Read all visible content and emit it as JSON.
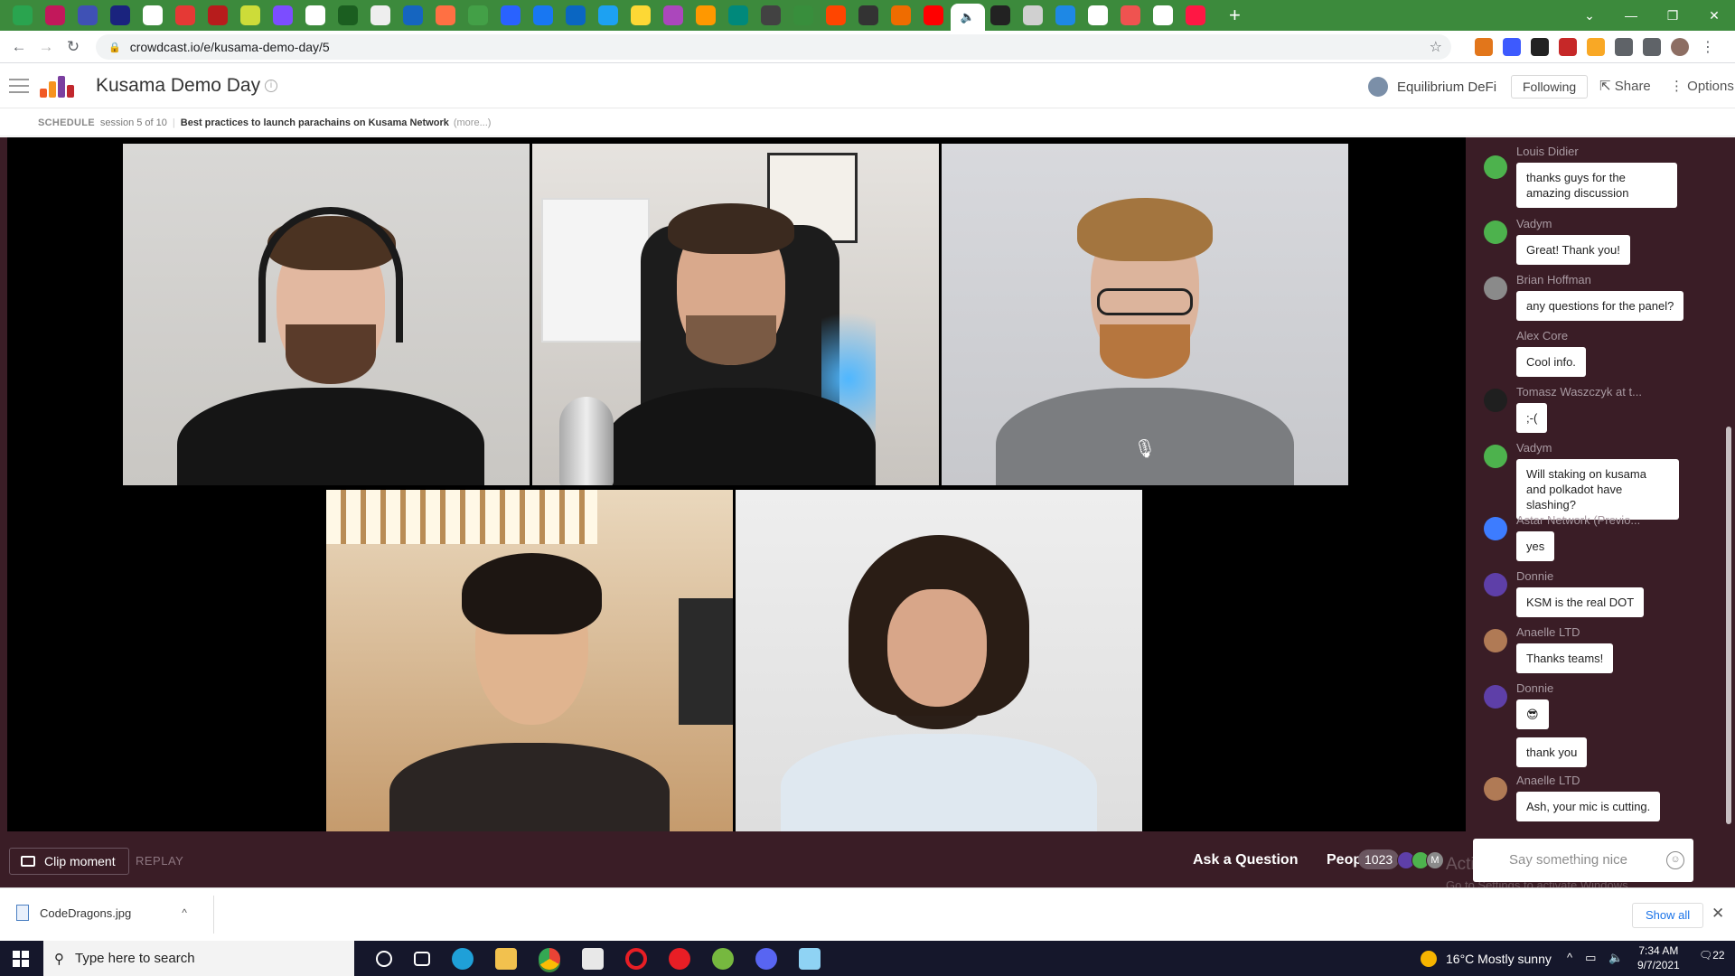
{
  "browser": {
    "url": "crowdcast.io/e/kusama-demo-day/5",
    "tab_audio_icon": "speaker-icon",
    "new_tab": "+",
    "window_controls": [
      "⌄",
      "—",
      "❐",
      "✕"
    ]
  },
  "header": {
    "title": "Kusama Demo Day",
    "host_name": "Equilibrium DeFi",
    "following_label": "Following",
    "share_label": "Share",
    "options_label": "Options"
  },
  "schedule": {
    "label": "SCHEDULE",
    "session": "session 5 of 10",
    "session_title": "Best practices to launch parachains on Kusama Network",
    "more": "(more...)"
  },
  "controls": {
    "clip_label": "Clip moment",
    "replay_label": "REPLAY",
    "ask_label": "Ask a Question",
    "people_label": "People",
    "people_count": "1023"
  },
  "chat": {
    "messages": [
      {
        "name": "Louis Didier",
        "text": "thanks guys for the amazing discussion",
        "avatar_color": "#4db24d"
      },
      {
        "name": "Vadym",
        "text": "Great! Thank you!",
        "avatar_color": "#4db24d"
      },
      {
        "name": "Brian Hoffman",
        "text": "any questions for the panel?",
        "avatar_color": "#8a8a8a"
      },
      {
        "name": "Alex Core",
        "text": "Cool info.",
        "avatar_color": ""
      },
      {
        "name": "Tomasz Waszczyk at t...",
        "text": ";-(",
        "avatar_color": "#1f1f1f"
      },
      {
        "name": "Vadym",
        "text": "Will staking on kusama and polkadot have slashing?",
        "avatar_color": "#4db24d"
      },
      {
        "name": "Astar Network (Previo...",
        "text": "yes",
        "avatar_color": "#3d7cff"
      },
      {
        "name": "Donnie",
        "text": "KSM is the real DOT",
        "avatar_color": "#5e3fa8"
      },
      {
        "name": "Anaelle LTD",
        "text": "Thanks teams!",
        "avatar_color": "#b07a55"
      },
      {
        "name": "Donnie",
        "text": "😎",
        "avatar_color": "#5e3fa8"
      },
      {
        "name": "",
        "text": "thank you",
        "avatar_color": ""
      },
      {
        "name": "Anaelle LTD",
        "text": "Ash, your mic is cutting.",
        "avatar_color": "#b07a55"
      }
    ],
    "input_placeholder": "Say something nice",
    "mini_avatar_letter": "M",
    "watermark_line1": "Activate Windows",
    "watermark_line2": "Go to Settings to activate Windows."
  },
  "download": {
    "filename": "CodeDragons.jpg",
    "show_all": "Show all"
  },
  "taskbar": {
    "search_placeholder": "Type here to search",
    "weather": "16°C  Mostly sunny",
    "time": "7:34 AM",
    "date": "9/7/2021",
    "notifications": "22"
  }
}
